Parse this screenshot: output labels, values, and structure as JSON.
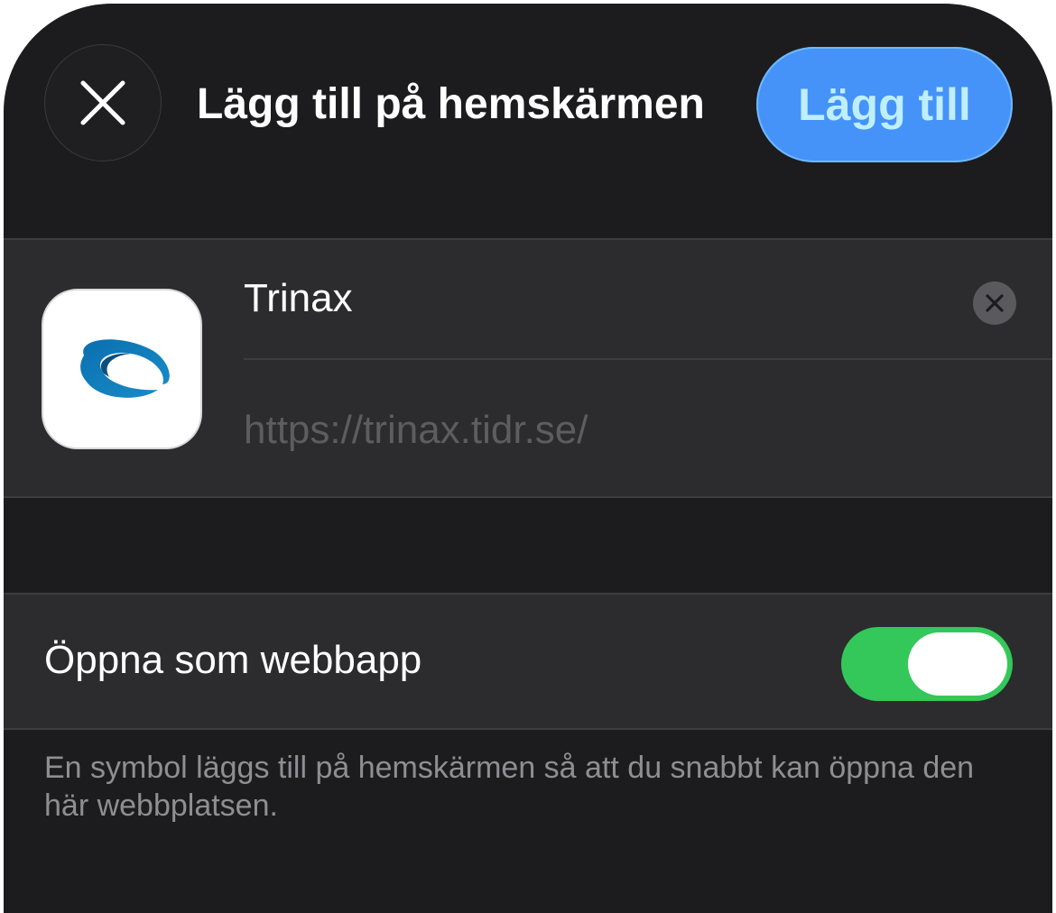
{
  "header": {
    "title": "Lägg till på hemskärmen",
    "add_label": "Lägg till",
    "close_icon": "close-icon"
  },
  "app": {
    "name": "Trinax",
    "url": "https://trinax.tidr.se/",
    "icon": "trinax-logo-icon",
    "clear_icon": "clear-field-icon"
  },
  "web_app_toggle": {
    "label": "Öppna som webbapp",
    "on": true
  },
  "footer": {
    "text": "En symbol läggs till på hemskärmen så att du snabbt kan öppna den här webbplatsen."
  },
  "colors": {
    "accent": "#4593f8",
    "toggle_on": "#34c759",
    "sheet_background": "#1c1c1e",
    "group_background": "#2c2c2e"
  }
}
